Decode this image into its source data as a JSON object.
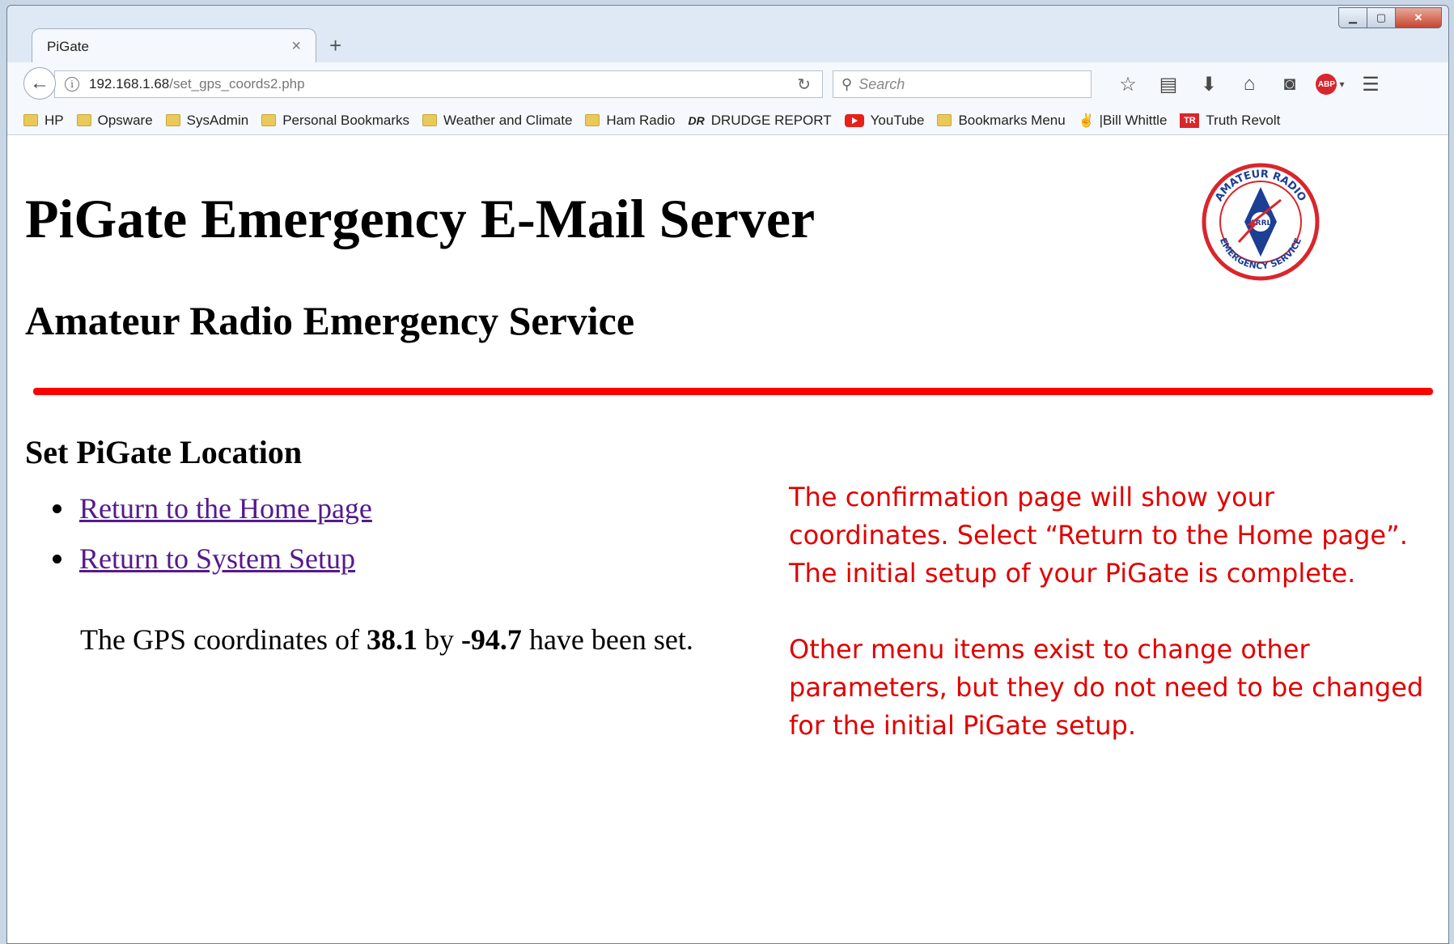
{
  "browser": {
    "tab_title": "PiGate",
    "tab_close": "×",
    "new_tab": "+",
    "url_host": "192.168.1.68",
    "url_path": "/set_gps_coords2.php",
    "search_placeholder": "Search",
    "toolbar_icons": [
      "bookmark-star-icon",
      "reading-list-icon",
      "download-icon",
      "home-icon",
      "pocket-icon",
      "adblock-plus-icon",
      "menu-icon"
    ]
  },
  "bookmarks": [
    {
      "label": "HP",
      "icon": "folder"
    },
    {
      "label": "Opsware",
      "icon": "folder"
    },
    {
      "label": "SysAdmin",
      "icon": "folder"
    },
    {
      "label": "Personal Bookmarks",
      "icon": "folder"
    },
    {
      "label": "Weather and Climate",
      "icon": "folder"
    },
    {
      "label": "Ham Radio",
      "icon": "folder"
    },
    {
      "label": "DRUDGE REPORT",
      "icon": "drudge"
    },
    {
      "label": "YouTube",
      "icon": "youtube"
    },
    {
      "label": "Bookmarks Menu",
      "icon": "folder"
    },
    {
      "label": "|Bill Whittle",
      "icon": "billwhittle"
    },
    {
      "label": "Truth Revolt",
      "icon": "truthrevolt"
    }
  ],
  "page": {
    "title": "PiGate Emergency E-Mail Server",
    "subtitle": "Amateur Radio Emergency Service",
    "section_title": "Set PiGate Location",
    "links": [
      "Return to the Home page",
      "Return to System Setup"
    ],
    "coords_prefix": "The GPS coordinates of ",
    "latitude": "38.1",
    "coords_mid": " by ",
    "longitude": "-94.7",
    "coords_suffix": " have been set."
  },
  "logo": {
    "top_text": "AMATEUR RADIO",
    "bottom_text": "EMERGENCY SERVICE",
    "center_text": "ARRL"
  },
  "annotations": {
    "first": [
      "The confirmation page will show your",
      "coordinates.  Select “Return to the Home page”.",
      "The initial setup of your PiGate is complete."
    ],
    "second": [
      "Other menu items exist to change other",
      "parameters, but they do not need to be changed",
      "for the initial PiGate setup."
    ]
  },
  "colors": {
    "rule": "#ff0000",
    "annotation": "#e00000",
    "link": "#551a8b"
  }
}
